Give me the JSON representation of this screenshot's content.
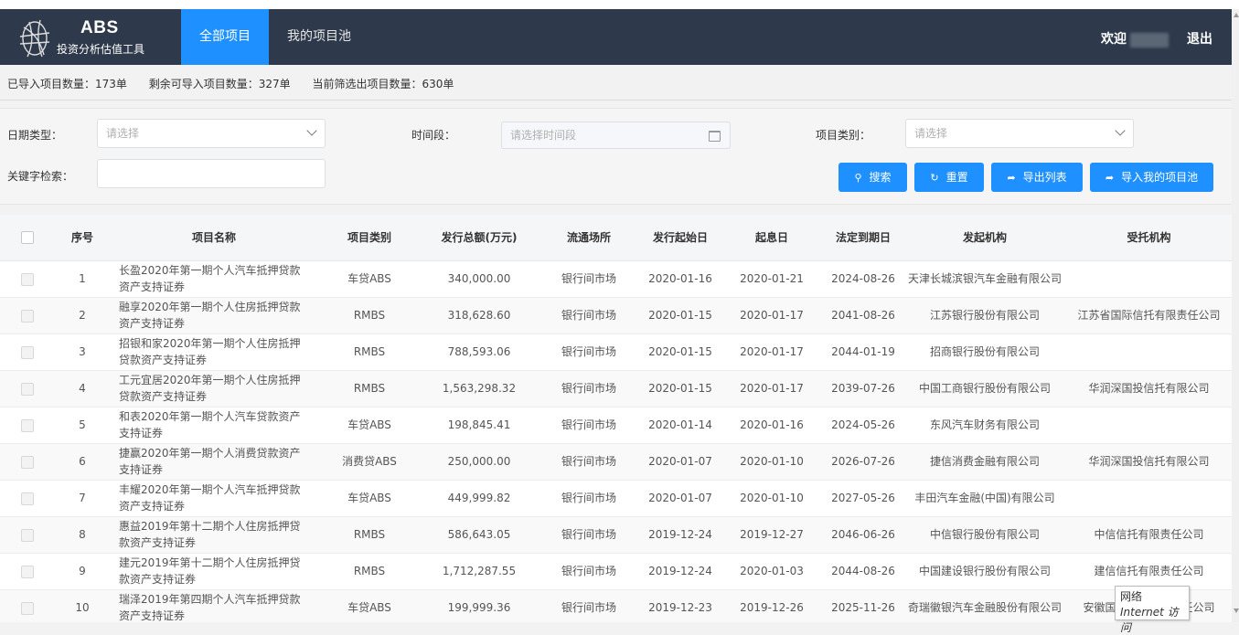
{
  "brand": {
    "title": "ABS",
    "subtitle": "投资分析估值工具"
  },
  "nav": {
    "tabs": [
      {
        "label": "全部项目"
      },
      {
        "label": "我的项目池"
      }
    ]
  },
  "user": {
    "welcome": "欢迎",
    "logout": "退出"
  },
  "stats": {
    "imported": "已导入项目数量：173单",
    "remaining": "剩余可导入项目数量：327单",
    "filtered": "当前筛选出项目数量：630单"
  },
  "filters": {
    "date_type_label": "日期类型：",
    "date_type_placeholder": "请选择",
    "period_label": "时间段：",
    "period_placeholder": "请选择时间段",
    "category_label": "项目类别：",
    "category_placeholder": "请选择",
    "keyword_label": "关键字检索：",
    "keyword_value": ""
  },
  "buttons": {
    "search": "搜索",
    "reset": "重置",
    "export": "导出列表",
    "import_pool": "导入我的项目池"
  },
  "table": {
    "headers": [
      "序号",
      "项目名称",
      "项目类别",
      "发行总额(万元)",
      "流通场所",
      "发行起始日",
      "起息日",
      "法定到期日",
      "发起机构",
      "受托机构"
    ],
    "rows": [
      [
        "1",
        "长盈2020年第一期个人汽车抵押贷款资产支持证券",
        "车贷ABS",
        "340,000.00",
        "银行间市场",
        "2020-01-16",
        "2020-01-21",
        "2024-08-26",
        "天津长城滨银汽车金融有限公司",
        ""
      ],
      [
        "2",
        "融享2020年第一期个人住房抵押贷款资产支持证券",
        "RMBS",
        "318,628.60",
        "银行间市场",
        "2020-01-15",
        "2020-01-17",
        "2041-08-26",
        "江苏银行股份有限公司",
        "江苏省国际信托有限责任公司"
      ],
      [
        "3",
        "招银和家2020年第一期个人住房抵押贷款资产支持证券",
        "RMBS",
        "788,593.06",
        "银行间市场",
        "2020-01-15",
        "2020-01-17",
        "2044-01-19",
        "招商银行股份有限公司",
        ""
      ],
      [
        "4",
        "工元宜居2020年第一期个人住房抵押贷款资产支持证券",
        "RMBS",
        "1,563,298.32",
        "银行间市场",
        "2020-01-15",
        "2020-01-17",
        "2039-07-26",
        "中国工商银行股份有限公司",
        "华润深国投信托有限公司"
      ],
      [
        "5",
        "和表2020年第一期个人汽车贷款资产支持证券",
        "车贷ABS",
        "198,845.41",
        "银行间市场",
        "2020-01-14",
        "2020-01-16",
        "2024-05-26",
        "东风汽车财务有限公司",
        ""
      ],
      [
        "6",
        "捷赢2020年第一期个人消费贷款资产支持证券",
        "消费贷ABS",
        "250,000.00",
        "银行间市场",
        "2020-01-07",
        "2020-01-10",
        "2026-07-26",
        "捷信消费金融有限公司",
        "华润深国投信托有限公司"
      ],
      [
        "7",
        "丰耀2020年第一期个人汽车抵押贷款资产支持证券",
        "车贷ABS",
        "449,999.82",
        "银行间市场",
        "2020-01-07",
        "2020-01-10",
        "2027-05-26",
        "丰田汽车金融(中国)有限公司",
        ""
      ],
      [
        "8",
        "惠益2019年第十二期个人住房抵押贷款资产支持证券",
        "RMBS",
        "586,643.05",
        "银行间市场",
        "2019-12-24",
        "2019-12-27",
        "2046-06-26",
        "中信银行股份有限公司",
        "中信信托有限责任公司"
      ],
      [
        "9",
        "建元2019年第十二期个人住房抵押贷款资产支持证券",
        "RMBS",
        "1,712,287.55",
        "银行间市场",
        "2019-12-24",
        "2020-01-03",
        "2044-08-26",
        "中国建设银行股份有限公司",
        "建信信托有限责任公司"
      ],
      [
        "10",
        "瑞泽2019年第四期个人汽车抵押贷款资产支持证券",
        "车贷ABS",
        "199,999.36",
        "银行间市场",
        "2019-12-23",
        "2019-12-26",
        "2025-11-26",
        "奇瑞徽银汽车金融股份有限公司",
        "安徽国元信托有限责任公司"
      ]
    ]
  },
  "tooltip": {
    "line1": "网络",
    "line2": "Internet 访问"
  }
}
